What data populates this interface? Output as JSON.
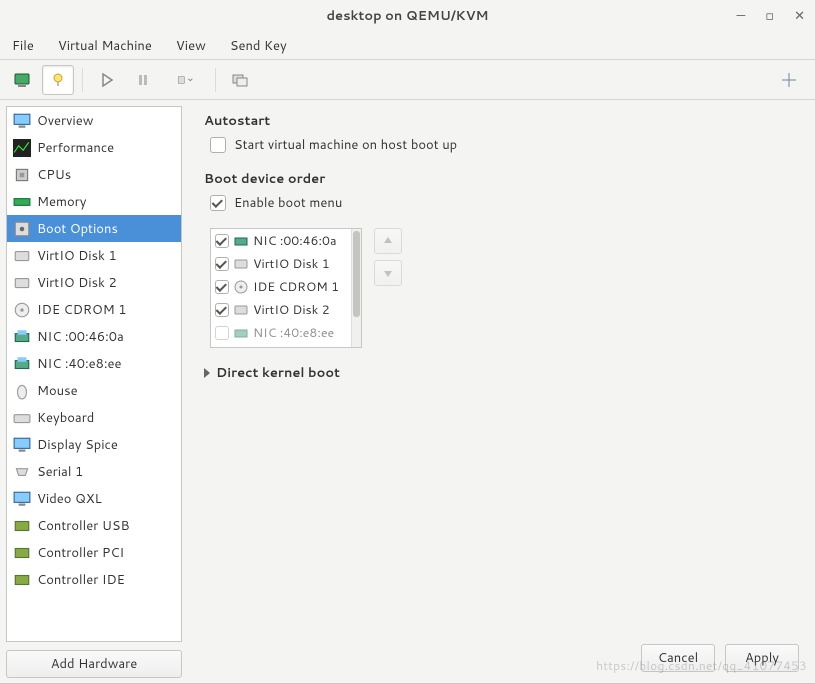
{
  "window": {
    "title": "desktop on QEMU/KVM"
  },
  "menu": {
    "file": "File",
    "virtual_machine": "Virtual Machine",
    "view": "View",
    "send_key": "Send Key"
  },
  "sidebar": {
    "items": [
      {
        "label": "Overview"
      },
      {
        "label": "Performance"
      },
      {
        "label": "CPUs"
      },
      {
        "label": "Memory"
      },
      {
        "label": "Boot Options"
      },
      {
        "label": "VirtIO Disk 1"
      },
      {
        "label": "VirtIO Disk 2"
      },
      {
        "label": "IDE CDROM 1"
      },
      {
        "label": "NIC :00:46:0a"
      },
      {
        "label": "NIC :40:e8:ee"
      },
      {
        "label": "Mouse"
      },
      {
        "label": "Keyboard"
      },
      {
        "label": "Display Spice"
      },
      {
        "label": "Serial 1"
      },
      {
        "label": "Video QXL"
      },
      {
        "label": "Controller USB"
      },
      {
        "label": "Controller PCI"
      },
      {
        "label": "Controller IDE"
      }
    ],
    "selected_index": 4,
    "add_hardware": "Add Hardware"
  },
  "content": {
    "autostart": {
      "heading": "Autostart",
      "checkbox_label": "Start virtual machine on host boot up",
      "checked": false
    },
    "boot_order": {
      "heading": "Boot device order",
      "enable_label": "Enable boot menu",
      "enable_checked": true,
      "devices": [
        {
          "label": "NIC :00:46:0a",
          "checked": true,
          "icon": "nic"
        },
        {
          "label": "VirtIO Disk 1",
          "checked": true,
          "icon": "disk"
        },
        {
          "label": "IDE CDROM 1",
          "checked": true,
          "icon": "cdrom"
        },
        {
          "label": "VirtIO Disk 2",
          "checked": true,
          "icon": "disk"
        },
        {
          "label": "NIC :40:e8:ee",
          "checked": false,
          "icon": "nic"
        }
      ]
    },
    "direct_kernel": "Direct kernel boot"
  },
  "footer": {
    "cancel": "Cancel",
    "apply": "Apply"
  }
}
